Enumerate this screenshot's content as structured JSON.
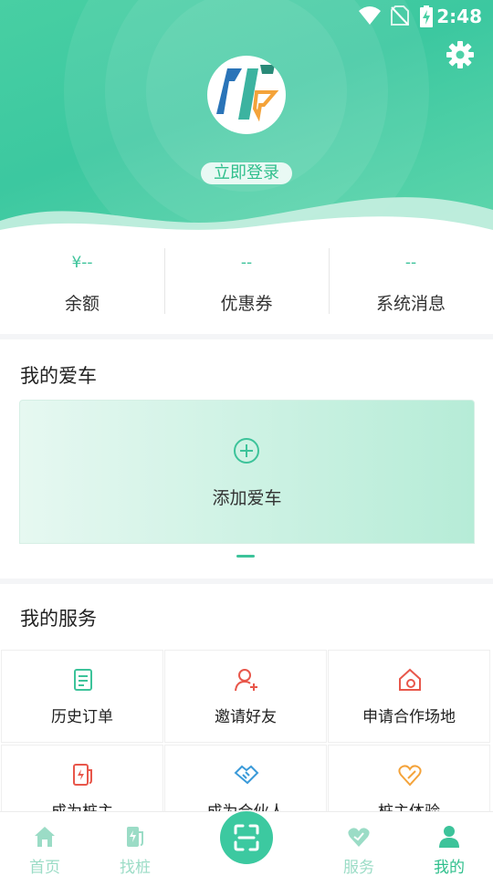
{
  "status_bar": {
    "time": "2:48",
    "icons": [
      "wifi-icon",
      "no-sim-icon",
      "battery-charging-icon"
    ]
  },
  "header": {
    "login_label": "立即登录",
    "settings_icon": "gear-icon"
  },
  "stats": [
    {
      "value": "¥--",
      "label": "余额"
    },
    {
      "value": "--",
      "label": "优惠券"
    },
    {
      "value": "--",
      "label": "系统消息"
    }
  ],
  "my_car": {
    "title": "我的爱车",
    "add_label": "添加爱车"
  },
  "services": {
    "title": "我的服务",
    "items": [
      {
        "label": "历史订单",
        "icon": "document-icon",
        "color": "#3cc39a"
      },
      {
        "label": "邀请好友",
        "icon": "add-user-icon",
        "color": "#e8574b"
      },
      {
        "label": "申请合作场地",
        "icon": "home-location-icon",
        "color": "#e8574b"
      },
      {
        "label": "成为桩主",
        "icon": "charger-icon",
        "color": "#e8574b"
      },
      {
        "label": "成为合伙人",
        "icon": "handshake-icon",
        "color": "#3a9ad9"
      },
      {
        "label": "桩主体验",
        "icon": "heart-pen-icon",
        "color": "#f4a33a"
      }
    ]
  },
  "nav": [
    {
      "label": "首页",
      "icon": "home-icon",
      "active": false
    },
    {
      "label": "找桩",
      "icon": "charging-station-icon",
      "active": false
    },
    {
      "label": "服务",
      "icon": "heart-icon",
      "active": false
    },
    {
      "label": "我的",
      "icon": "user-icon",
      "active": true
    }
  ],
  "colors": {
    "primary": "#3cc39a",
    "accent_red": "#e8574b",
    "accent_blue": "#3a9ad9",
    "accent_orange": "#f4a33a"
  }
}
